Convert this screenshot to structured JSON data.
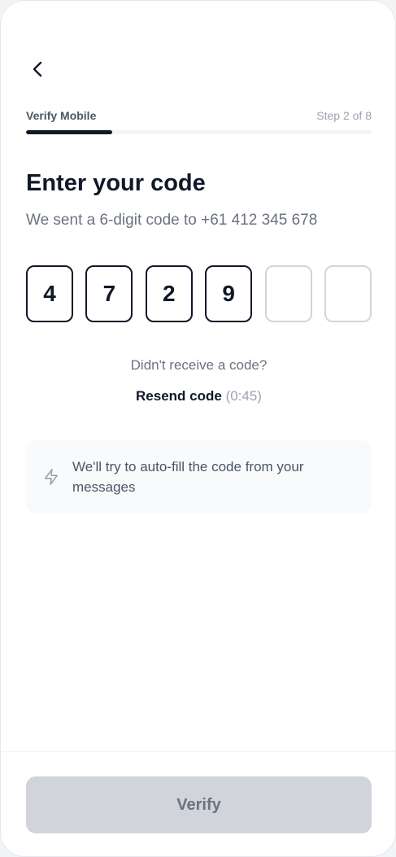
{
  "header": {
    "back_icon": "chevron-left-icon",
    "step_label": "Verify Mobile",
    "step_counter": "Step 2 of 8",
    "progress_fraction": 0.25
  },
  "main": {
    "title": "Enter your code",
    "subtitle": "We sent a 6-digit code to +61 412 345 678",
    "code_digits": [
      "4",
      "7",
      "2",
      "9",
      "",
      ""
    ],
    "didnt_receive": "Didn't receive a code?",
    "resend_label": "Resend code",
    "resend_timer": "(0:45)",
    "info_icon": "lightning-icon",
    "info_text": "We'll try to auto-fill the code from your messages"
  },
  "footer": {
    "verify_label": "Verify"
  },
  "colors": {
    "primary": "#111827",
    "muted_text": "#6b7280",
    "disabled_button": "#d1d5db",
    "empty_box_border": "#d1d5db",
    "info_background": "#f8fafc"
  }
}
